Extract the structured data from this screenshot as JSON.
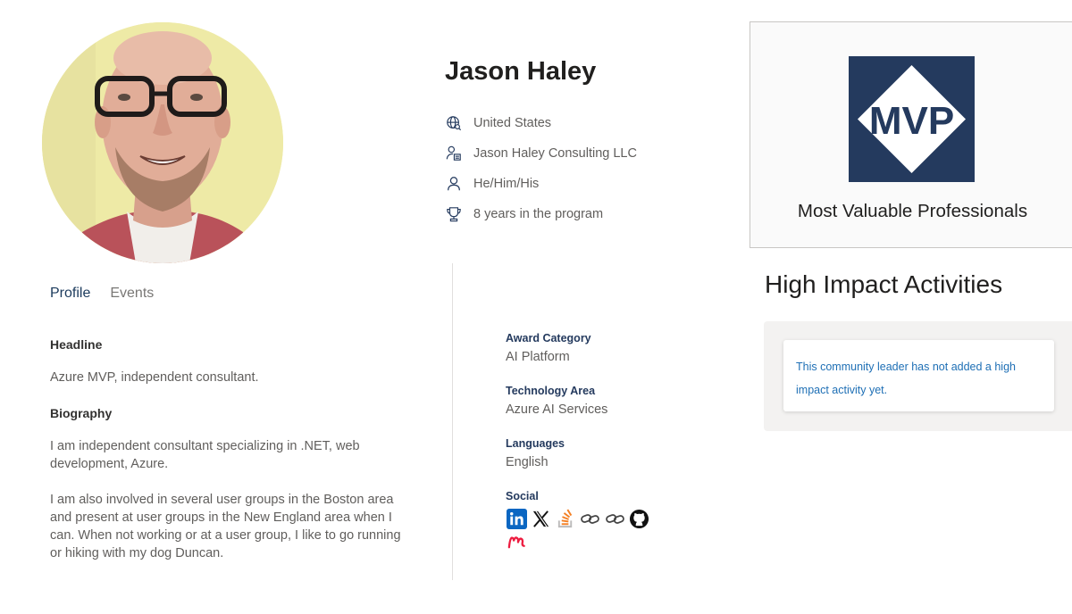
{
  "profile": {
    "name": "Jason Haley",
    "facts": [
      {
        "icon": "globe-icon",
        "text": "United States"
      },
      {
        "icon": "person-building-icon",
        "text": "Jason Haley Consulting LLC"
      },
      {
        "icon": "person-icon",
        "text": "He/Him/His"
      },
      {
        "icon": "trophy-icon",
        "text": "8 years in the program"
      }
    ]
  },
  "mvp_card": {
    "logo_text": "MVP",
    "title": "Most Valuable Professionals",
    "logo_color": "#243a5e"
  },
  "tabs": [
    {
      "label": "Profile",
      "active": true
    },
    {
      "label": "Events",
      "active": false
    }
  ],
  "headline": {
    "label": "Headline",
    "text": "Azure MVP, independent consultant."
  },
  "biography": {
    "label": "Biography",
    "paragraphs": [
      "I am independent consultant specializing in .NET, web development, Azure.",
      "I am also involved in several user groups in the Boston area and present at user groups in the New England area when I can. When not working or at a user group, I like to go running or hiking with my dog Duncan."
    ]
  },
  "details": {
    "award_category": {
      "label": "Award Category",
      "value": "AI Platform"
    },
    "technology_area": {
      "label": "Technology Area",
      "value": "Azure AI Services"
    },
    "languages": {
      "label": "Languages",
      "value": "English"
    },
    "social": {
      "label": "Social",
      "icons": [
        "linkedin-icon",
        "x-icon",
        "stackoverflow-icon",
        "link-icon",
        "link-icon",
        "github-icon",
        "meetup-icon"
      ]
    }
  },
  "high_impact": {
    "title": "High Impact Activities",
    "message": "This community leader has not added a high impact activity yet."
  },
  "colors": {
    "accent_navy": "#243a5e",
    "link_blue": "#1e6fb5",
    "linkedin": "#0a66c2",
    "stackoverflow": "#f48024",
    "meetup": "#ed1c40"
  }
}
